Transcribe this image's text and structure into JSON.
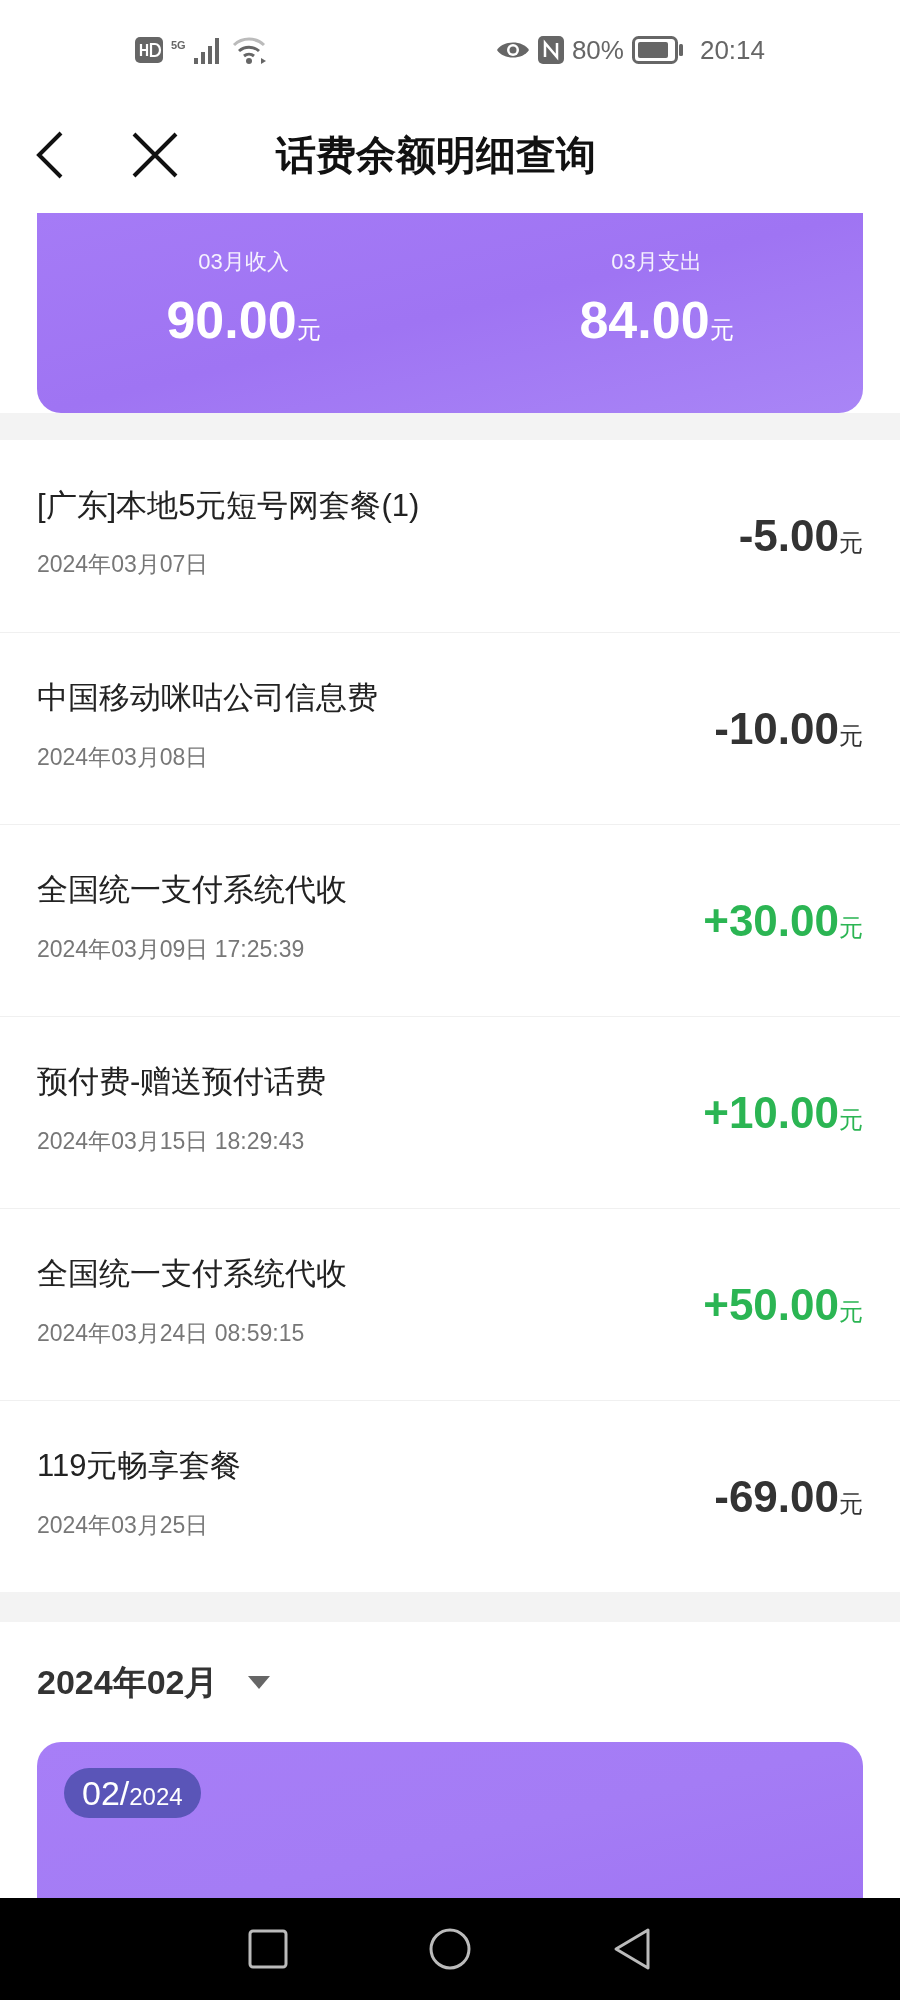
{
  "status_bar": {
    "network": "5G",
    "battery": "80%",
    "time": "20:14"
  },
  "header": {
    "title": "话费余额明细查询"
  },
  "summary": {
    "income_label": "03月收入",
    "income": "90.00",
    "expense_label": "03月支出",
    "expense": "84.00",
    "income_unit": "元",
    "expense_unit": "元"
  },
  "records": [
    {
      "title": "[广东]本地5元短号网套餐(1)",
      "date": "2024年03月07日",
      "amount": "-5.00",
      "unit": "元",
      "kind": "expense"
    },
    {
      "title": "中国移动咪咕公司信息费",
      "date": "2024年03月08日",
      "amount": "-10.00",
      "unit": "元",
      "kind": "expense"
    },
    {
      "title": "全国统一支付系统代收",
      "date": "2024年03月09日 17:25:39",
      "amount": "+30.00",
      "unit": "元",
      "kind": "income"
    },
    {
      "title": "预付费-赠送预付话费",
      "date": "2024年03月15日 18:29:43",
      "amount": "+10.00",
      "unit": "元",
      "kind": "income"
    },
    {
      "title": "全国统一支付系统代收",
      "date": "2024年03月24日 08:59:15",
      "amount": "+50.00",
      "unit": "元",
      "kind": "income"
    },
    {
      "title": "119元畅享套餐",
      "date": "2024年03月25日",
      "amount": "-69.00",
      "unit": "元",
      "kind": "expense"
    }
  ],
  "next_month": {
    "label": "2024年02月",
    "badge_month": "02/",
    "badge_year": "2024"
  }
}
